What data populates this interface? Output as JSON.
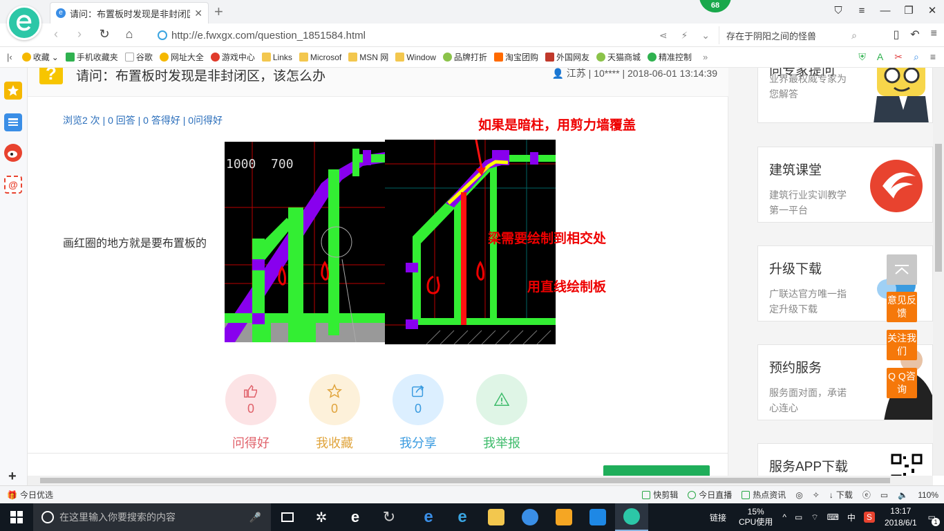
{
  "browser": {
    "tab_title": "请问：布置板时发现是非封闭区",
    "badge_count": "68",
    "url": "http://e.fwxgx.com/question_1851584.html",
    "search_text": "存在于阴阳之间的怪兽"
  },
  "bookmarks": [
    {
      "label": "收藏",
      "color": "#f5b800"
    },
    {
      "label": "手机收藏夹",
      "color": "#2fb14f"
    },
    {
      "label": "谷歌",
      "color": "#9aa0a6"
    },
    {
      "label": "网址大全",
      "color": "#f5b800"
    },
    {
      "label": "游戏中心",
      "color": "#e03b2b"
    },
    {
      "label": "Links",
      "color": "#f3c74e"
    },
    {
      "label": "Microsof",
      "color": "#f3c74e"
    },
    {
      "label": "MSN 网",
      "color": "#f3c74e"
    },
    {
      "label": "Window",
      "color": "#f3c74e"
    },
    {
      "label": "品牌打折",
      "color": "#8bc34a"
    },
    {
      "label": "淘宝团购",
      "color": "#ff6a00"
    },
    {
      "label": "外国网友",
      "color": "#c0392b"
    },
    {
      "label": "天猫商城",
      "color": "#8bc34a"
    },
    {
      "label": "精准控制",
      "color": "#2fb14f"
    }
  ],
  "question": {
    "title": "请问：布置板时发现是非封闭区，该怎么办",
    "meta": "江苏 | 10**** | 2018-06-01 13:14:39",
    "stats": "浏览2 次 | 0 回答 | 0 答得好 | 0问得好",
    "text": "画红圈的地方就是要布置板的",
    "img1_dims": "1000  700",
    "annotations": {
      "a1": "如果是暗柱，用剪力墙覆盖",
      "a2": "梁需要绘制到相交处",
      "a3": "用直线绘制板"
    }
  },
  "actions": [
    {
      "label": "问得好",
      "count": "0",
      "color": "#e0616a",
      "bg": "#fce3e5",
      "icon": "thumbs-up-icon"
    },
    {
      "label": "我收藏",
      "count": "0",
      "color": "#e0a43c",
      "bg": "#fdf1da",
      "icon": "star-icon"
    },
    {
      "label": "我分享",
      "count": "0",
      "color": "#3a9be0",
      "bg": "#dcefff",
      "icon": "share-icon"
    },
    {
      "label": "我举报",
      "count": "0",
      "color": "#3dbb6a",
      "bg": "#dff5e6",
      "icon": "warning-icon"
    }
  ],
  "sidebar_cards": [
    {
      "title": "向专家提问",
      "sub": "业界最权威专家为您解答"
    },
    {
      "title": "建筑课堂",
      "sub": "建筑行业实训教学第一平台"
    },
    {
      "title": "升级下载",
      "sub": "广联达官方唯一指定升级下载"
    },
    {
      "title": "预约服务",
      "sub": "服务面对面，承诺心连心"
    },
    {
      "title": "服务APP下载",
      "sub": ""
    }
  ],
  "float_buttons": {
    "feedback": "意见反馈",
    "follow": "关注我们",
    "qq": "Q Q咨询"
  },
  "statusbar": {
    "left": "今日优选",
    "items": [
      "快剪辑",
      "今日直播",
      "热点资讯",
      "下载"
    ],
    "zoom": "110%"
  },
  "taskbar": {
    "search_placeholder": "在这里输入你要搜索的内容",
    "link": "链接",
    "cpu_percent": "15%",
    "cpu_label": "CPU使用",
    "ime": "中",
    "time": "13:17",
    "date": "2018/6/1",
    "notify_count": "1"
  }
}
